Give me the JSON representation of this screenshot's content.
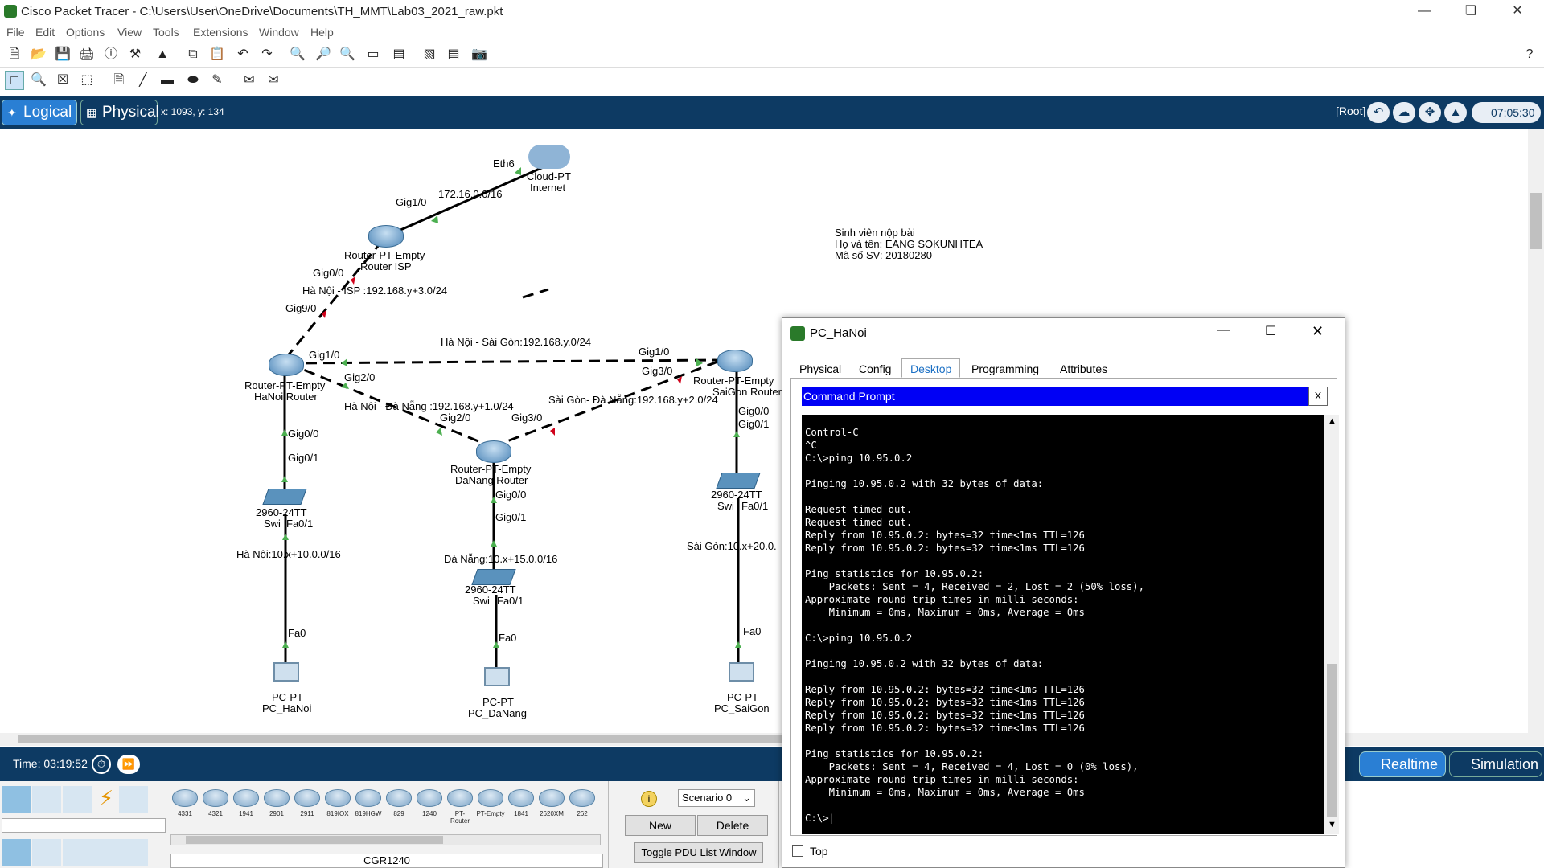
{
  "window": {
    "title": "Cisco Packet Tracer - C:\\Users\\User\\OneDrive\\Documents\\TH_MMT\\Lab03_2021_raw.pkt"
  },
  "menu": [
    "File",
    "Edit",
    "Options",
    "View",
    "Tools",
    "Extensions",
    "Window",
    "Help"
  ],
  "nav": {
    "logical": "Logical",
    "physical": "Physical",
    "coords": "x: 1093, y: 134",
    "root": "[Root]",
    "clock": "07:05:30"
  },
  "topology": {
    "note": {
      "line1": "Sinh viên nộp bài",
      "line2": "Họ và tên: EANG SOKUNHTEA",
      "line3": "Mã số SV: 20180280"
    },
    "cloud": {
      "port": "Eth6",
      "type": "Cloud-PT",
      "name": "Internet"
    },
    "link_cloud_isp": "172.16.0.0/16",
    "isp": {
      "type": "Router-PT-Empty",
      "name": "Router ISP",
      "gig10": "Gig1/0",
      "gig00": "Gig0/0"
    },
    "link_hanoi_isp": "Hà Nội - ISP :192.168.y+3.0/24",
    "hanoi": {
      "type": "Router-PT-Empty",
      "name": "HaNoi Router",
      "gig90": "Gig9/0",
      "gig10": "Gig1/0",
      "gig20": "Gig2/0",
      "gig00": "Gig0/0"
    },
    "saigon": {
      "type": "Router-PT-Empty",
      "name": "SaiGon Router",
      "gig10": "Gig1/0",
      "gig30": "Gig3/0",
      "gig00": "Gig0/0"
    },
    "danang": {
      "type": "Router-PT-Empty",
      "name": "DaNang Router",
      "gig20": "Gig2/0",
      "gig30": "Gig3/0",
      "gig00": "Gig0/0"
    },
    "link_hanoi_saigon": "Hà Nội - Sài Gòn:192.168.y.0/24",
    "link_hanoi_danang": "Hà Nội - Đà Nẵng :192.168.y+1.0/24",
    "link_saigon_danang": "Sài Gòn- Đà Nẵng:192.168.y+2.0/24",
    "switch_type": "2960-24TT",
    "switch_name": "Swi",
    "sw_gig01": "Gig0/1",
    "sw_fa01": "Fa0/1",
    "pc_fa0": "Fa0",
    "lan_hanoi": "Hà Nội:10.x+10.0.0/16",
    "lan_danang": "Đà Nẵng:10.x+15.0.0/16",
    "lan_saigon": "Sài Gòn:10.x+20.0.",
    "pc_type": "PC-PT",
    "pc_hanoi": "PC_HaNoi",
    "pc_danang": "PC_DaNang",
    "pc_saigon": "PC_SaiGon"
  },
  "bottom": {
    "time": "Time: 03:19:52",
    "realtime": "Realtime",
    "simulation": "Simulation",
    "scenario": "Scenario 0",
    "new": "New",
    "delete": "Delete",
    "toggle_pdu": "Toggle PDU List Window",
    "selected_model": "CGR1240",
    "models": [
      "4331",
      "4321",
      "1941",
      "2901",
      "2911",
      "819IOX",
      "819HGW",
      "829",
      "1240",
      "PT-Router",
      "PT-Empty",
      "1841",
      "2620XM",
      "262"
    ]
  },
  "pc_window": {
    "title": "PC_HaNoi",
    "tabs": [
      "Physical",
      "Config",
      "Desktop",
      "Programming",
      "Attributes"
    ],
    "active_tab": "Desktop",
    "cmd_title": "Command Prompt",
    "close": "X",
    "top_checkbox": "Top",
    "terminal": "Control-C\n^C\nC:\\>ping 10.95.0.2\n\nPinging 10.95.0.2 with 32 bytes of data:\n\nRequest timed out.\nRequest timed out.\nReply from 10.95.0.2: bytes=32 time<1ms TTL=126\nReply from 10.95.0.2: bytes=32 time<1ms TTL=126\n\nPing statistics for 10.95.0.2:\n    Packets: Sent = 4, Received = 2, Lost = 2 (50% loss),\nApproximate round trip times in milli-seconds:\n    Minimum = 0ms, Maximum = 0ms, Average = 0ms\n\nC:\\>ping 10.95.0.2\n\nPinging 10.95.0.2 with 32 bytes of data:\n\nReply from 10.95.0.2: bytes=32 time<1ms TTL=126\nReply from 10.95.0.2: bytes=32 time<1ms TTL=126\nReply from 10.95.0.2: bytes=32 time<1ms TTL=126\nReply from 10.95.0.2: bytes=32 time<1ms TTL=126\n\nPing statistics for 10.95.0.2:\n    Packets: Sent = 4, Received = 4, Lost = 0 (0% loss),\nApproximate round trip times in milli-seconds:\n    Minimum = 0ms, Maximum = 0ms, Average = 0ms\n\nC:\\>|"
  }
}
